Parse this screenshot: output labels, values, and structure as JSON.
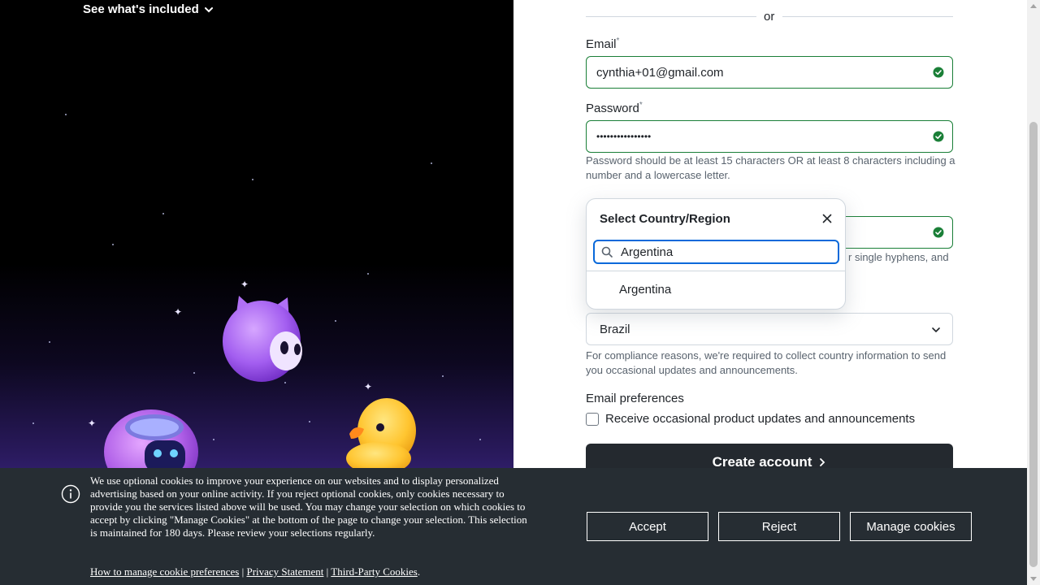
{
  "hero": {
    "included_label": "See what's included"
  },
  "form": {
    "divider_or": "or",
    "email": {
      "label": "Email",
      "required_mark": "*",
      "value": "cynthia+01@gmail.com"
    },
    "password": {
      "label": "Password",
      "required_mark": "*",
      "value": "••••••••••••••••",
      "hint": "Password should be at least 15 characters OR at least 8 characters including a number and a lowercase letter."
    },
    "username": {
      "hint_partial": "r single hyphens, and"
    },
    "country": {
      "value": "Brazil",
      "hint": "For compliance reasons, we're required to collect country information to send you occasional updates and announcements."
    },
    "email_prefs": {
      "heading": "Email preferences",
      "checkbox_label": "Receive occasional product updates and announcements"
    },
    "create_button": "Create account"
  },
  "popup": {
    "title": "Select Country/Region",
    "search_value": "Argentina",
    "option": "Argentina"
  },
  "cookie": {
    "text": "We use optional cookies to improve your experience on our websites and to display personalized advertising based on your online activity. If you reject optional cookies, only cookies necessary to provide you the services listed above will be used. You may change your selection on which cookies to accept by clicking \"Manage Cookies\" at the bottom of the page to change your selection. This selection is maintained for 180 days. Please review your selections regularly.",
    "link_manage": "How to manage cookie preferences",
    "link_privacy": "Privacy Statement",
    "link_third": "Third-Party Cookies",
    "sep": "|",
    "accept": "Accept",
    "reject": "Reject",
    "manage": "Manage cookies"
  },
  "colors": {
    "success": "#1a7f37",
    "focus": "#0969da",
    "button_dark": "#24292f",
    "banner": "#262d33"
  },
  "icons": [
    "chevron-down-icon",
    "check-circle-icon",
    "close-icon",
    "search-icon",
    "chevron-right-icon",
    "info-icon"
  ]
}
